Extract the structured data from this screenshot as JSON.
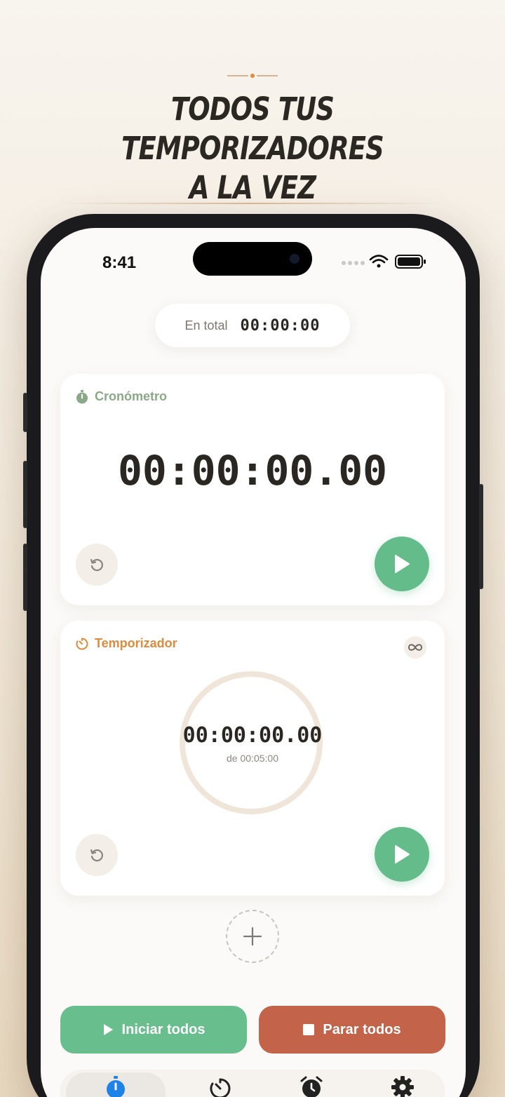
{
  "headline": {
    "line1": "TODOS TUS TEMPORIZADORES",
    "line2": "A LA VEZ"
  },
  "status_bar": {
    "time": "8:41"
  },
  "total": {
    "label": "En total",
    "value": "00:00:00"
  },
  "stopwatch_card": {
    "label": "Cronómetro",
    "icon": "stopwatch-icon",
    "time": "00:00:00.00"
  },
  "timer_card": {
    "label": "Temporizador",
    "icon": "timer-icon",
    "time": "00:00:00.00",
    "of_duration": "de 00:05:00",
    "progress": 0
  },
  "actions": {
    "start_all": "Iniciar todos",
    "stop_all": "Parar todos"
  },
  "tabs": [
    {
      "icon": "stopwatch-icon",
      "active": true
    },
    {
      "icon": "timer-icon",
      "active": false
    },
    {
      "icon": "alarm-clock-icon",
      "active": false
    },
    {
      "icon": "gear-icon",
      "active": false
    }
  ],
  "colors": {
    "accent_green": "#64bc8a",
    "accent_red": "#c2634a",
    "label_green": "#8aa987",
    "label_orange": "#df8a3c",
    "active_tab_blue": "#1e82e6"
  }
}
